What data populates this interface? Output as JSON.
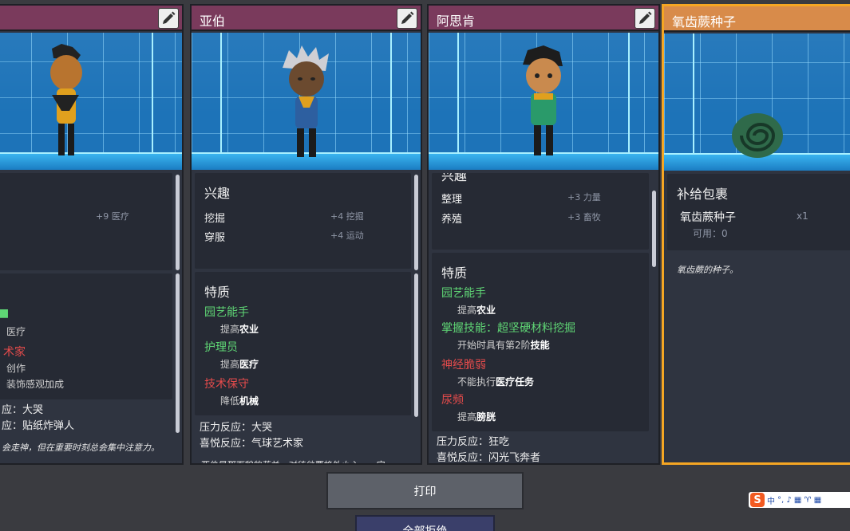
{
  "cards": [
    {
      "name": "",
      "interests": [
        {
          "label": "",
          "value": "+9 医疗"
        }
      ],
      "traits": [
        {
          "name": "",
          "kind": "good",
          "desc": "医疗"
        },
        {
          "name": "术家",
          "kind": "bad",
          "desc": "创作"
        },
        {
          "name": "",
          "kind": "info",
          "desc": "装饰感观加成"
        }
      ],
      "stress": "应：大哭",
      "joy": "应：贴纸炸弹人",
      "description": "会走神，但在重要时刻总会集中注意力。"
    },
    {
      "name": "亚伯",
      "interests_title": "兴趣",
      "interests": [
        {
          "label": "挖掘",
          "value": "+4 挖掘"
        },
        {
          "label": "穿服",
          "value": "+4 运动"
        }
      ],
      "traits_title": "特质",
      "traits": [
        {
          "name": "园艺能手",
          "kind": "good",
          "desc_pre": "提高",
          "desc_bold": "农业"
        },
        {
          "name": "护理员",
          "kind": "good",
          "desc_pre": "提高",
          "desc_bold": "医疗"
        },
        {
          "name": "技术保守",
          "kind": "bad",
          "desc_pre": "降低",
          "desc_bold": "机械"
        }
      ],
      "stress": "压力反应：大哭",
      "joy": "喜悦反应：气球艺术家",
      "description": "亚伯是那面貌的芬兰，对待他要格外小心……完"
    },
    {
      "name": "阿思肯",
      "interests_title": "兴趣",
      "interests": [
        {
          "label": "整理",
          "value": "+3 力量"
        },
        {
          "label": "养殖",
          "value": "+3 畜牧"
        }
      ],
      "traits_title": "特质",
      "traits": [
        {
          "name": "园艺能手",
          "kind": "good",
          "desc_pre": "提高",
          "desc_bold": "农业"
        },
        {
          "name": "掌握技能：超坚硬材料挖掘",
          "kind": "good",
          "desc_pre": "开始时具有第2阶",
          "desc_bold": "技能"
        },
        {
          "name": "神经脆弱",
          "kind": "bad",
          "desc_pre": "不能执行",
          "desc_bold": "医疗任务"
        },
        {
          "name": "尿频",
          "kind": "bad",
          "desc_pre": "提高",
          "desc_bold": "膀胱"
        }
      ],
      "stress": "压力反应：狂吃",
      "joy": "喜悦反应：闪光飞奔者"
    },
    {
      "name": "氧齿蕨种子",
      "package_title": "补给包裹",
      "item_name": "氧齿蕨种子",
      "item_qty": "x1",
      "available": "可用：0",
      "description": "氧齿蕨的种子。"
    }
  ],
  "buttons": {
    "print": "打印",
    "reject_all": "全部拒绝"
  },
  "ime": {
    "label": "中",
    "icons": "°, ♪ ▦ ♈ ▦"
  },
  "colors": {
    "header_dupe": "#7a3a5c",
    "header_package": "#d88b4a",
    "selected_border": "#f5a623"
  },
  "icons": {
    "edit": "pencil-icon",
    "seed": "seed-icon"
  }
}
